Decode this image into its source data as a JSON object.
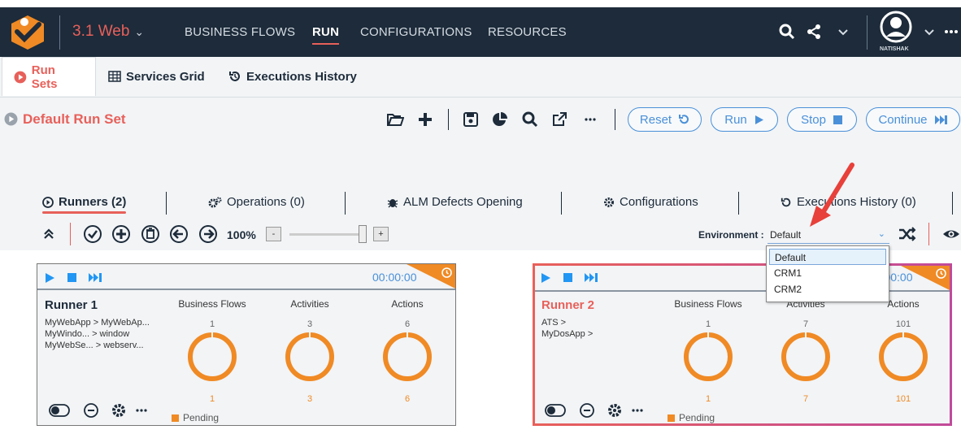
{
  "app": {
    "version_label": "3.1 Web"
  },
  "topnav": [
    {
      "label": "BUSINESS FLOWS"
    },
    {
      "label": "RUN"
    },
    {
      "label": "CONFIGURATIONS"
    },
    {
      "label": "RESOURCES"
    }
  ],
  "user": {
    "name": "NATISHAK"
  },
  "subtabs": [
    {
      "label": "Run Sets"
    },
    {
      "label": "Services Grid"
    },
    {
      "label": "Executions History"
    }
  ],
  "runset": {
    "title": "Default Run Set"
  },
  "actions": {
    "reset": "Reset",
    "run": "Run",
    "stop": "Stop",
    "continue": "Continue"
  },
  "innertabs": [
    {
      "label": "Runners (2)"
    },
    {
      "label": "Operations (0)"
    },
    {
      "label": "ALM Defects Opening"
    },
    {
      "label": "Configurations"
    },
    {
      "label": "Executions History (0)"
    }
  ],
  "zoom": {
    "value": "100%",
    "minus": "-",
    "plus": "+"
  },
  "environment": {
    "label": "Environment :",
    "selected": "Default",
    "options": [
      "Default",
      "CRM1",
      "CRM2"
    ]
  },
  "columns": [
    "Business Flows",
    "Activities",
    "Actions"
  ],
  "runners": [
    {
      "name": "Runner 1",
      "time": "00:00:00",
      "apps": "MyWebApp > MyWebAp...\nMyWindo... > window\nMyWebSe... > webserv...",
      "totals": [
        "1",
        "3",
        "6"
      ],
      "pending_counts": [
        "1",
        "3",
        "6"
      ],
      "status": "Pending"
    },
    {
      "name": "Runner 2",
      "time": "00:00:00",
      "apps": "ATS >\nMyDosApp >",
      "totals": [
        "1",
        "7",
        "101"
      ],
      "pending_counts": [
        "1",
        "7",
        "101"
      ],
      "status": "Pending"
    }
  ],
  "colors": {
    "accent": "#e8605a",
    "blue": "#4a90d9",
    "pending": "#f08a24",
    "navbar": "#1d2b3a"
  }
}
